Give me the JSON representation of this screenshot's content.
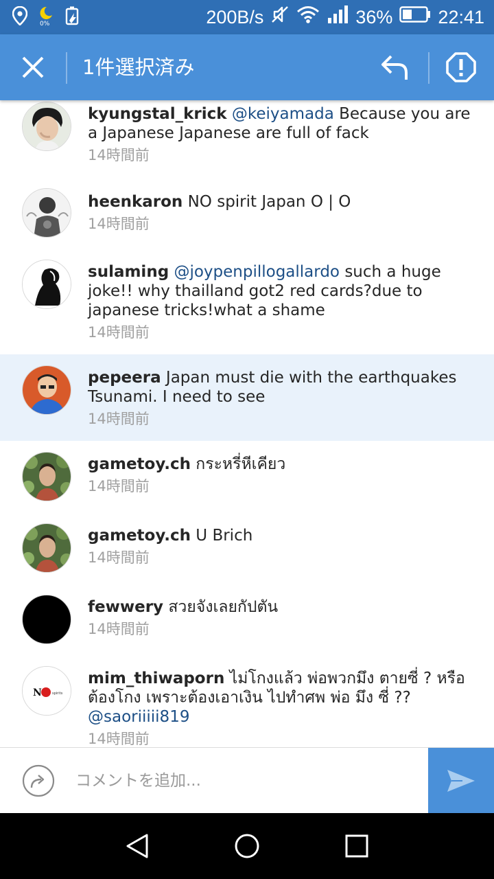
{
  "status_bar": {
    "network_speed": "200B/s",
    "battery_percent": "36%",
    "time": "22:41",
    "icons": [
      "location-icon",
      "moon-icon",
      "battery-saver-icon",
      "mute-icon",
      "wifi-icon",
      "signal-icon",
      "battery-icon"
    ]
  },
  "action_bar": {
    "title": "1件選択済み",
    "icons": [
      "close-icon",
      "reply-icon",
      "report-icon"
    ]
  },
  "comments": [
    {
      "username": "kyungstal_krick",
      "mention": "@keiyamada",
      "text": " Because you are a Japanese Japanese are full of fack",
      "time": "14時間前",
      "selected": false
    },
    {
      "username": "heenkaron",
      "mention": "",
      "text": " NO spirit  Japan  O | O",
      "time": "14時間前",
      "selected": false
    },
    {
      "username": "sulaming",
      "mention": "@joypenpillogallardo",
      "text": " such a huge joke!! why thailland got2 red cards?due to japanese tricks!what a shame",
      "time": "14時間前",
      "selected": false
    },
    {
      "username": "pepeera",
      "mention": "",
      "text": " Japan must die with the earthquakes Tsunami.  I need to see",
      "time": "14時間前",
      "selected": true
    },
    {
      "username": "gametoy.ch",
      "mention": "",
      "text": " กระหรี่หีเคียว",
      "time": "14時間前",
      "selected": false
    },
    {
      "username": "gametoy.ch",
      "mention": "",
      "text": " U Brich",
      "time": "14時間前",
      "selected": false
    },
    {
      "username": "fewwery",
      "mention": "",
      "text": " สวยจังเลยกัปตัน",
      "time": "14時間前",
      "selected": false
    },
    {
      "username": "mim_thiwaporn",
      "mention": "",
      "text": " ไม่โกงแล้ว พ่อพวกมึง ตายซี่ ? หรือต้องโกง เพราะต้องเอาเงิน ไปทำศพ พ่อ มึง ซี่ ??",
      "mention_after": "@saoriiiii819",
      "time": "14時間前",
      "selected": false
    }
  ],
  "avatar_logo": {
    "letter": "N",
    "small": "spirits"
  },
  "comment_input": {
    "placeholder": "コメントを追加...",
    "value": ""
  },
  "colors": {
    "status_bar": "#2f6fb5",
    "action_bar": "#4a90d9",
    "selected_row": "#e9f2fb",
    "mention": "#1d4f86",
    "timestamp": "#a0a0a0",
    "send_button": "#4a90d9"
  }
}
